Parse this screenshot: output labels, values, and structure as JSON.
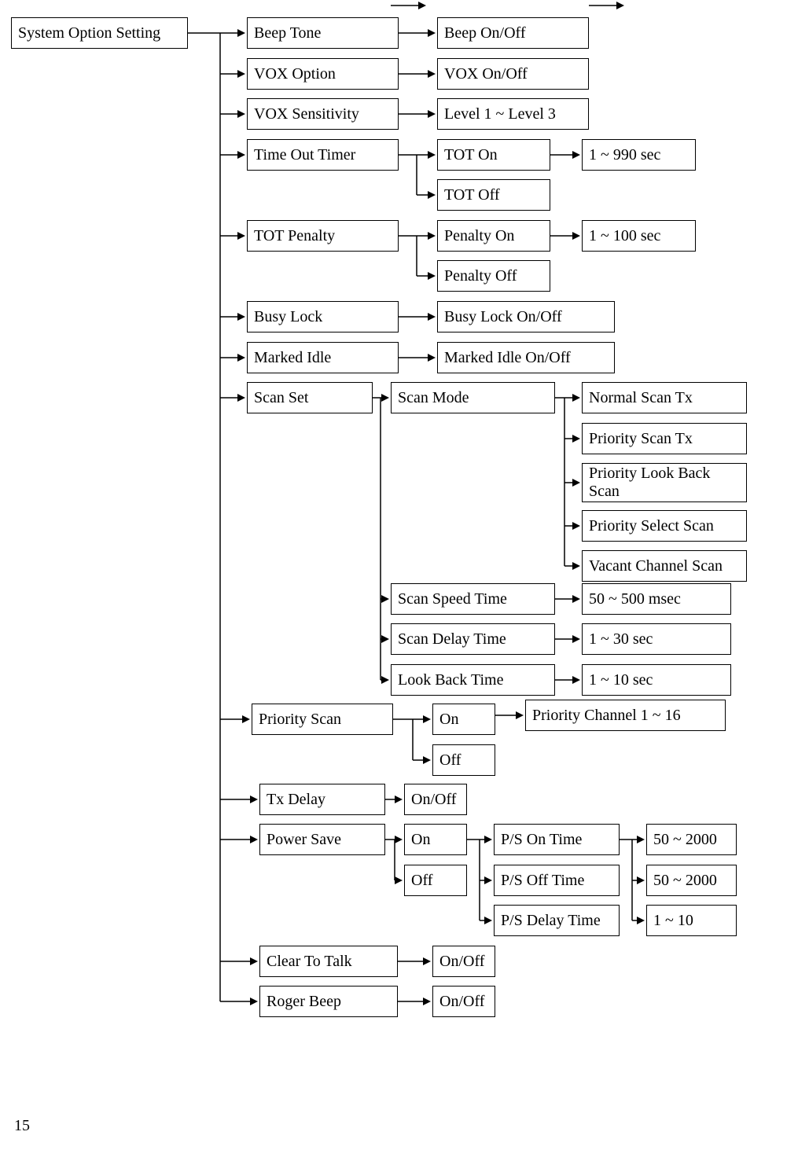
{
  "page_number": "15",
  "root": "System Option Setting",
  "level1": {
    "beep_tone": "Beep Tone",
    "vox_option": "VOX Option",
    "vox_sensitivity": "VOX Sensitivity",
    "time_out_timer": "Time Out Timer",
    "tot_penalty": "TOT Penalty",
    "busy_lock": "Busy Lock",
    "marked_idle": "Marked Idle",
    "scan_set": "Scan Set",
    "priority_scan": "Priority Scan",
    "tx_delay": "Tx Delay",
    "power_save": "Power Save",
    "clear_to_talk": "Clear To Talk",
    "roger_beep": "Roger Beep"
  },
  "level2": {
    "beep_onoff": "Beep On/Off",
    "vox_onoff": "VOX On/Off",
    "vox_levels": "Level 1 ~ Level 3",
    "tot_on": "TOT On",
    "tot_off": "TOT Off",
    "penalty_on": "Penalty On",
    "penalty_off": "Penalty Off",
    "busy_lock_onoff": "Busy Lock On/Off",
    "marked_idle_onoff": "Marked Idle On/Off",
    "scan_mode": "Scan Mode",
    "scan_speed_time": "Scan Speed Time",
    "scan_delay_time": "Scan Delay Time",
    "look_back_time": "Look Back Time",
    "priority_on": "On",
    "priority_off": "Off",
    "txdelay_onoff": "On/Off",
    "ps_on": "On",
    "ps_off": "Off",
    "ctt_onoff": "On/Off",
    "roger_onoff": "On/Off"
  },
  "level3": {
    "tot_range": "1 ~ 990 sec",
    "penalty_range": "1 ~ 100 sec",
    "scan_mode_normal": "Normal Scan Tx",
    "scan_mode_priority_tx": "Priority Scan Tx",
    "scan_mode_priority_lookback": "Priority Look Back Scan",
    "scan_mode_priority_select": "Priority Select Scan",
    "scan_mode_vacant": "Vacant Channel Scan",
    "scan_speed_range": "50 ~ 500 msec",
    "scan_delay_range": "1 ~ 30 sec",
    "look_back_range": "1 ~ 10 sec",
    "priority_channel_range": "Priority Channel 1 ~ 16",
    "ps_on_time": "P/S On Time",
    "ps_off_time": "P/S Off Time",
    "ps_delay_time": "P/S Delay Time"
  },
  "level4": {
    "ps_on_range": "50 ~ 2000",
    "ps_off_range": "50 ~ 2000",
    "ps_delay_range": "1 ~ 10"
  }
}
